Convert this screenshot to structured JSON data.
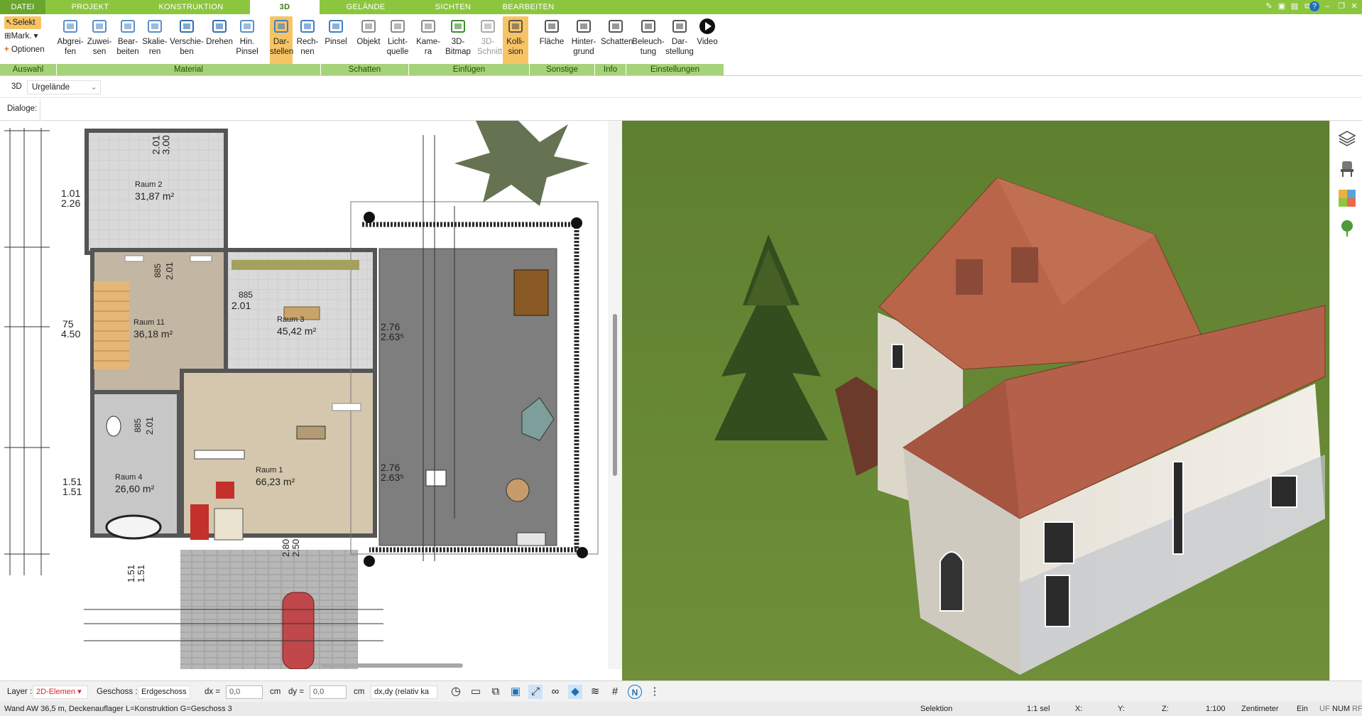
{
  "tabs": [
    "DATEI",
    "PROJEKT",
    "KONSTRUKTION",
    "3D",
    "GELÄNDE",
    "SICHTEN",
    "BEARBEITEN"
  ],
  "selection": {
    "select": "Selekt",
    "mark": "Mark.",
    "options": "Optionen"
  },
  "ribbon": {
    "buttons": [
      {
        "l1": "Abgrei-",
        "l2": "fen"
      },
      {
        "l1": "Zuwei-",
        "l2": "sen"
      },
      {
        "l1": "Bear-",
        "l2": "beiten"
      },
      {
        "l1": "Skalie-",
        "l2": "ren"
      },
      {
        "l1": "Verschie-",
        "l2": "ben"
      },
      {
        "l1": "Drehen",
        "l2": ""
      },
      {
        "l1": "Hin.",
        "l2": "Pinsel"
      },
      {
        "l1": "Dar-",
        "l2": "stellen"
      },
      {
        "l1": "Rech-",
        "l2": "nen"
      },
      {
        "l1": "Pinsel",
        "l2": ""
      },
      {
        "l1": "Objekt",
        "l2": ""
      },
      {
        "l1": "Licht-",
        "l2": "quelle"
      },
      {
        "l1": "Kame-",
        "l2": "ra"
      },
      {
        "l1": "3D-",
        "l2": "Bitmap"
      },
      {
        "l1": "3D-",
        "l2": "Schnitt"
      },
      {
        "l1": "Kolli-",
        "l2": "sion"
      },
      {
        "l1": "Fläche",
        "l2": ""
      },
      {
        "l1": "Hinter-",
        "l2": "grund"
      },
      {
        "l1": "Schatten",
        "l2": ""
      },
      {
        "l1": "Beleuch-",
        "l2": "tung"
      },
      {
        "l1": "Dar-",
        "l2": "stellung"
      },
      {
        "l1": "Video",
        "l2": ""
      }
    ],
    "groups": [
      "Auswahl",
      "Material",
      "Schatten",
      "Einfügen",
      "Sonstige",
      "Info",
      "Einstellungen"
    ]
  },
  "viewbar": {
    "mode": "3D",
    "level": "Urgelände"
  },
  "dialogbar": {
    "label": "Dialoge:"
  },
  "rooms": [
    {
      "name": "Raum 2",
      "area": "31,87 m²"
    },
    {
      "name": "Raum 11",
      "area": "36,18 m²"
    },
    {
      "name": "Raum 3",
      "area": "45,42 m²"
    },
    {
      "name": "Raum 1",
      "area": "66,23 m²"
    },
    {
      "name": "Raum 4",
      "area": "26,60 m²"
    }
  ],
  "dims": {
    "d1": "2.01",
    "d2": "3.00",
    "d3": "1.01",
    "d4": "2.26",
    "d5": "885",
    "d6": "2.01",
    "d7": "885",
    "d8": "2.01",
    "d9": "75",
    "d10": "4.50",
    "d11": "2.76",
    "d12": "2.63⁵",
    "d13": "885",
    "d14": "2.01",
    "d15": "2.76",
    "d16": "2.63⁵",
    "d17": "1.51",
    "d18": "1.51",
    "d19": "2.80",
    "d20": "2.50",
    "d21": "1.51",
    "d22": "1.51"
  },
  "bottombar": {
    "layer_label": "Layer :",
    "layer_value": "2D-Elemen",
    "floor_label": "Geschoss :",
    "floor_value": "Erdgeschoss",
    "dx_label": "dx =",
    "dx_value": "0,0",
    "dx_unit": "cm",
    "dy_label": "dy =",
    "dy_value": "0,0",
    "dy_unit": "cm",
    "mode_value": "dx,dy (relativ ka"
  },
  "statusbar": {
    "info": "Wand AW 36,5 m, Deckenauflager L=Konstruktion G=Geschoss 3",
    "mode": "Selektion",
    "sel": "1:1 sel",
    "x": "X:",
    "y": "Y:",
    "z": "Z:",
    "scale": "1:100",
    "unit": "Zentimeter",
    "ein": "Ein",
    "uf": "UF",
    "num": "NUM",
    "rf": "RF"
  },
  "colors": {
    "accent": "#8cc63f",
    "group": "#a6d27a",
    "active_btn": "#f7c465",
    "roof": "#b9654a",
    "grass": "#5b7d2e"
  }
}
